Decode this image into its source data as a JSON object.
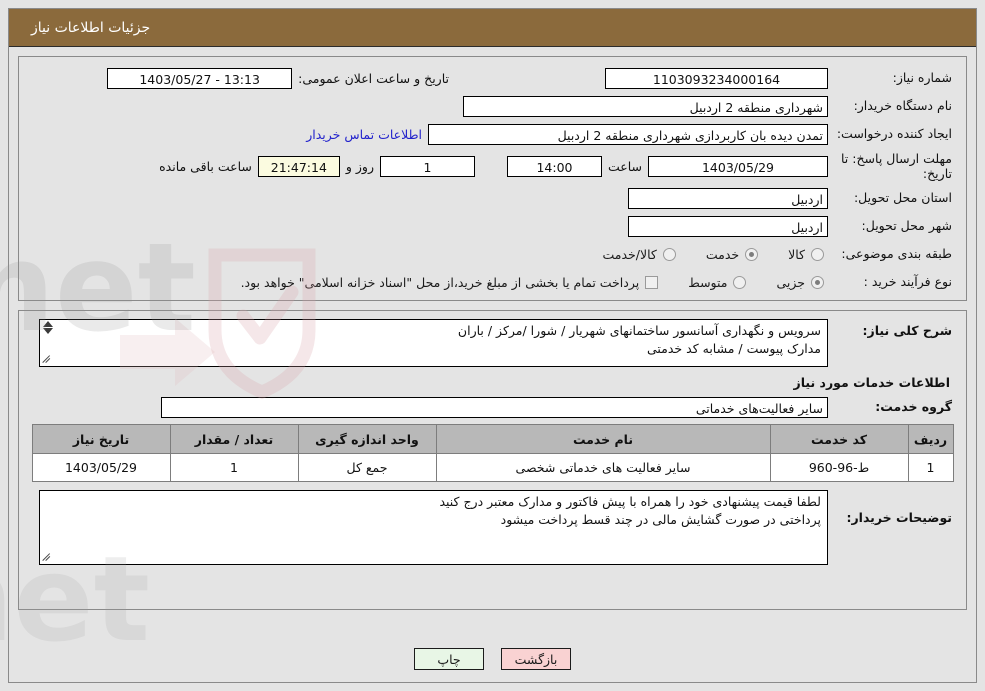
{
  "header": {
    "title": "جزئیات اطلاعات نیاز"
  },
  "info": {
    "need_number_label": "شماره نیاز:",
    "need_number_value": "1103093234000164",
    "announce_label": "تاریخ و ساعت اعلان عمومی:",
    "announce_value": "13:13 - 1403/05/27",
    "buyer_org_label": "نام دستگاه خریدار:",
    "buyer_org_value": "شهرداری منطقه 2 اردبیل",
    "requester_label": "ایجاد کننده درخواست:",
    "requester_value": "تمدن دیده بان کاربردازی شهرداری منطقه 2 اردبیل",
    "contact_link": "اطلاعات تماس خریدار",
    "deadline_label": "مهلت ارسال پاسخ: تا تاریخ:",
    "deadline_date": "1403/05/29",
    "hour_label": "ساعت",
    "deadline_time": "14:00",
    "days_value": "1",
    "days_label": "روز و",
    "countdown_value": "21:47:14",
    "remaining_label": "ساعت باقی مانده",
    "province_label": "استان محل تحویل:",
    "province_value": "اردبیل",
    "city_label": "شهر محل تحویل:",
    "city_value": "اردبیل",
    "category_label": "طبقه بندی موضوعی:",
    "category_options": [
      {
        "label": "کالا",
        "selected": false
      },
      {
        "label": "خدمت",
        "selected": true
      },
      {
        "label": "کالا/خدمت",
        "selected": false
      }
    ],
    "process_label": "نوع فرآیند خرید :",
    "process_options": [
      {
        "label": "جزیی",
        "selected": true
      },
      {
        "label": "متوسط",
        "selected": false
      }
    ],
    "treasury_checkbox_text": "پرداخت تمام یا بخشی از مبلغ خرید،از محل \"اسناد خزانه اسلامی\" خواهد بود.",
    "treasury_checked": false
  },
  "description": {
    "label": "شرح کلی نیاز:",
    "value": "سرویس و نگهداری آسانسور ساختمانهای شهریار / شورا  /مرکز / باران\nمدارک پیوست / مشابه کد خدمتی"
  },
  "services_section": {
    "heading": "اطلاعات خدمات مورد نیاز",
    "group_label": "گروه خدمت:",
    "group_value": "سایر فعالیت‌های خدماتی"
  },
  "table": {
    "columns": [
      "ردیف",
      "کد خدمت",
      "نام خدمت",
      "واحد اندازه گیری",
      "تعداد / مقدار",
      "تاریخ نیاز"
    ],
    "rows": [
      [
        "1",
        "ط-96-960",
        "سایر فعالیت های خدماتی شخصی",
        "جمع کل",
        "1",
        "1403/05/29"
      ]
    ]
  },
  "buyer_notes": {
    "label": "توضیحات خریدار:",
    "value": "لطفا قیمت پیشنهادی خود را همراه با پیش فاکتور و مدارک معتبر درج کنید\nپرداختی در صورت گشایش مالی در چند قسط پرداخت میشود"
  },
  "footer": {
    "print_label": "چاپ",
    "back_label": "بازگشت"
  },
  "watermark": {
    "text": "AriaTender.net"
  }
}
